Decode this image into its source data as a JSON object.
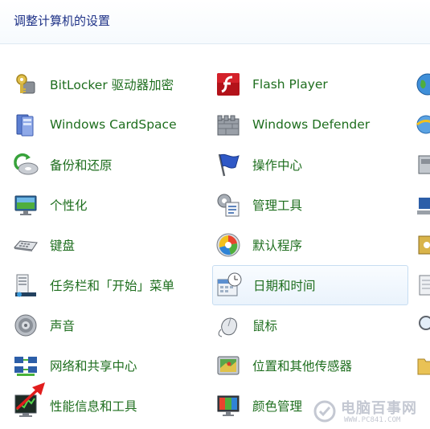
{
  "header": {
    "title": "调整计算机的设置"
  },
  "col1": [
    {
      "label": "BitLocker 驱动器加密",
      "icon": "bitlocker-key-icon"
    },
    {
      "label": "Windows CardSpace",
      "icon": "cardspace-icon"
    },
    {
      "label": "备份和还原",
      "icon": "backup-restore-icon"
    },
    {
      "label": "个性化",
      "icon": "personalization-icon"
    },
    {
      "label": "键盘",
      "icon": "keyboard-icon"
    },
    {
      "label": "任务栏和「开始」菜单",
      "icon": "taskbar-start-menu-icon"
    },
    {
      "label": "声音",
      "icon": "speaker-icon"
    },
    {
      "label": "网络和共享中心",
      "icon": "network-sharing-icon"
    },
    {
      "label": "性能信息和工具",
      "icon": "performance-icon"
    }
  ],
  "col2": [
    {
      "label": "Flash Player",
      "icon": "flash-player-icon"
    },
    {
      "label": "Windows Defender",
      "icon": "defender-castle-icon"
    },
    {
      "label": "操作中心",
      "icon": "action-center-flag-icon"
    },
    {
      "label": "管理工具",
      "icon": "admin-tools-icon"
    },
    {
      "label": "默认程序",
      "icon": "default-programs-icon"
    },
    {
      "label": "日期和时间",
      "icon": "date-time-icon"
    },
    {
      "label": "鼠标",
      "icon": "mouse-icon"
    },
    {
      "label": "位置和其他传感器",
      "icon": "location-sensors-icon"
    },
    {
      "label": "颜色管理",
      "icon": "color-management-icon"
    }
  ],
  "col2_selected_index": 5,
  "watermark": {
    "text": "电脑百事网",
    "url": "WWW.PC841.COM"
  }
}
